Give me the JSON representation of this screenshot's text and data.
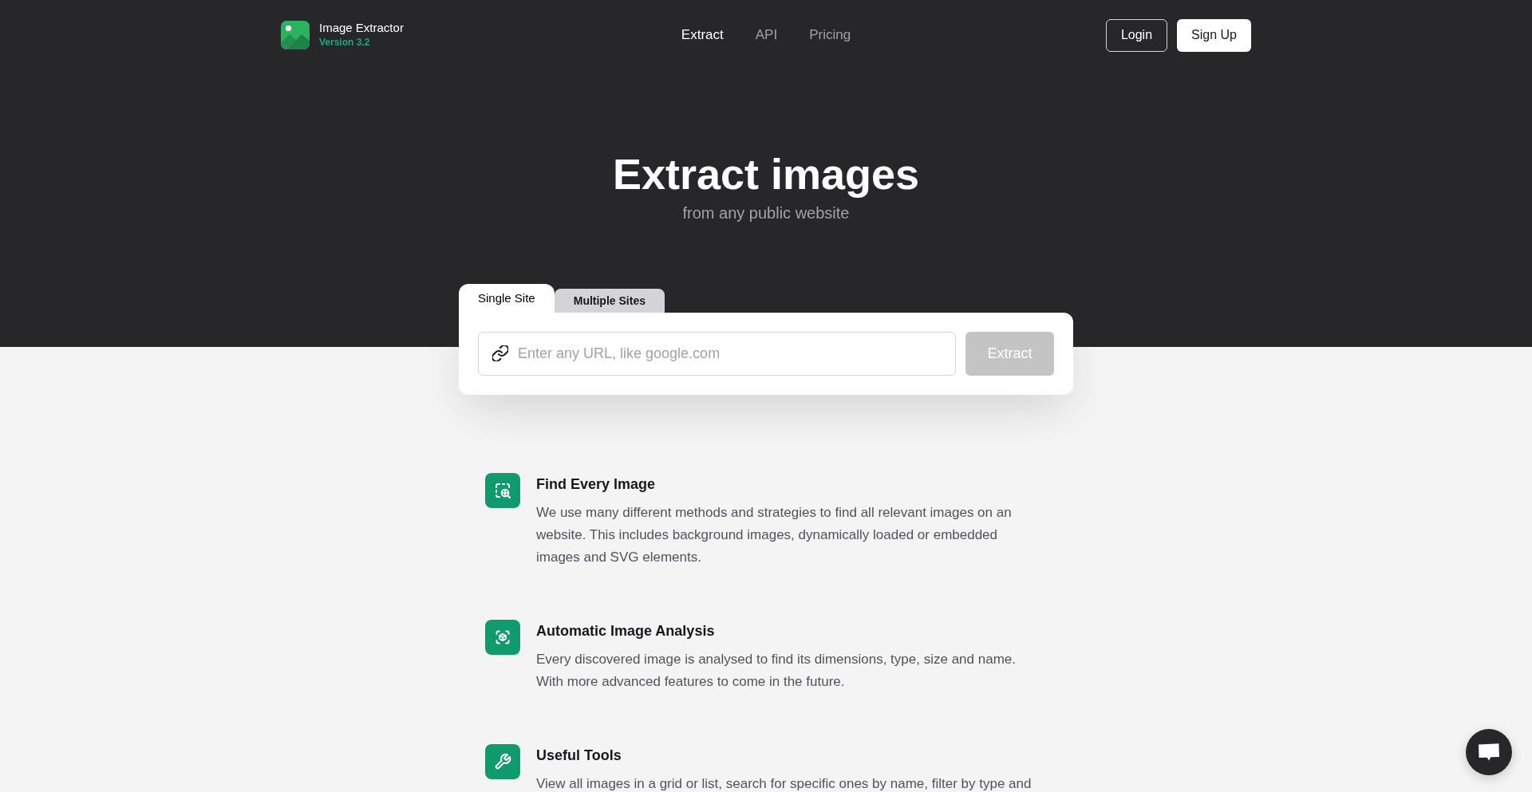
{
  "header": {
    "logo": {
      "name": "Image Extractor",
      "version": "Version 3.2"
    },
    "nav": [
      {
        "label": "Extract",
        "selected": true
      },
      {
        "label": "API",
        "selected": false
      },
      {
        "label": "Pricing",
        "selected": false
      }
    ],
    "buttons": [
      {
        "label": "Login",
        "kind": "outline"
      },
      {
        "label": "Sign Up",
        "kind": "solid"
      }
    ]
  },
  "hero": {
    "title": "Extract images",
    "subtitle": "from any public website"
  },
  "extractor": {
    "tabs": [
      {
        "label": "Single Site",
        "selected": true
      },
      {
        "label": "Multiple Sites",
        "selected": false
      }
    ],
    "url_field": {
      "placeholder": "Enter any URL, like google.com"
    },
    "submit": {
      "label": "Extract",
      "disabled": true
    }
  },
  "features": [
    {
      "title": "Find Every Image",
      "description": "We use many different methods and strategies to find all relevant images on an website. This includes background images, dynamically loaded or embedded images and SVG elements."
    },
    {
      "title": "Automatic Image Analysis",
      "description": "Every discovered image is analysed to find its dimensions, type, size and name. With more advanced features to come in the future."
    },
    {
      "title": "Useful Tools",
      "description": "View all images in a grid or list, search for specific ones by name, filter by type and"
    }
  ]
}
